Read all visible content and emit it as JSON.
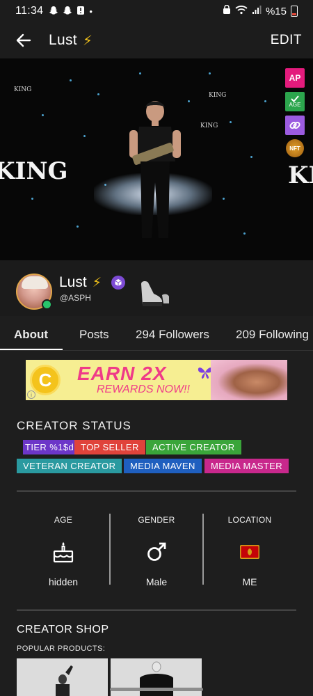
{
  "status_bar": {
    "time": "11:34",
    "dot": "•",
    "battery_text": "%15",
    "icons": [
      "snapchat-icon",
      "snapchat-icon",
      "alert-icon",
      "wifi-icon",
      "signal-icon",
      "battery-icon"
    ]
  },
  "app_bar": {
    "back_icon": "arrow-left-icon",
    "title": "Lust",
    "title_emoji": "⚡",
    "edit_label": "EDIT"
  },
  "hero": {
    "king_left": "KING",
    "king_right": "KING",
    "king_small": "KING",
    "badges": {
      "ap": "AP",
      "age": "AGE",
      "nft": "NFT"
    }
  },
  "profile": {
    "name": "Lust",
    "name_emoji": "⚡",
    "handle": "@ASPH",
    "online": true
  },
  "tabs": [
    {
      "label": "About",
      "active": true
    },
    {
      "label": "Posts",
      "active": false
    },
    {
      "label": "294 Followers",
      "active": false
    },
    {
      "label": "209 Following",
      "active": false
    }
  ],
  "promo": {
    "headline": "EARN 2X",
    "subline": "REWARDS NOW!!",
    "coin_symbol": "C"
  },
  "creator_status": {
    "title": "CREATOR STATUS",
    "chips": [
      {
        "label": "TIER %1$d",
        "color": "#6c36c8"
      },
      {
        "label": "TOP SELLER",
        "color": "#e0433b"
      },
      {
        "label": "ACTIVE CREATOR",
        "color": "#3aa53a"
      },
      {
        "label": "VETERAN CREATOR",
        "color": "#2a9aa0"
      },
      {
        "label": "MEDIA MAVEN",
        "color": "#1f5fbf"
      },
      {
        "label": "MEDIA MASTER",
        "color": "#c8288c"
      }
    ]
  },
  "info": {
    "age": {
      "label": "AGE",
      "value": "hidden",
      "icon": "cake-icon"
    },
    "gender": {
      "label": "GENDER",
      "value": "Male",
      "icon": "male-symbol-icon"
    },
    "location": {
      "label": "LOCATION",
      "value": "ME",
      "icon": "montenegro-flag-icon"
    }
  },
  "shop": {
    "title": "CREATOR SHOP",
    "popular_label": "POPULAR PRODUCTS:"
  }
}
